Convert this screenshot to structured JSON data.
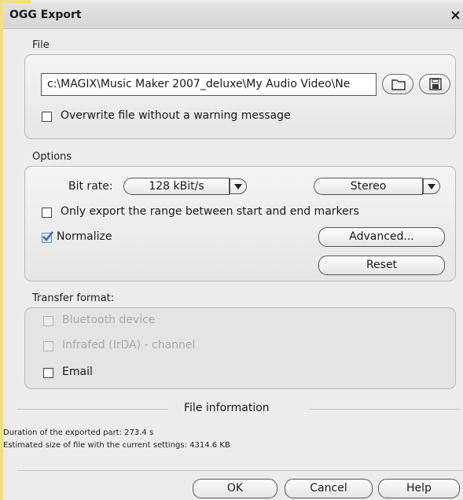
{
  "window": {
    "title": "OGG Export",
    "close_glyph": "×"
  },
  "file": {
    "section_label": "File",
    "path_value": "c:\\MAGIX\\Music Maker 2007_deluxe\\My Audio Video\\Ne",
    "overwrite_label": "Overwrite file without a warning message",
    "overwrite_checked": false
  },
  "options": {
    "section_label": "Options",
    "bitrate_label": "Bit rate:",
    "bitrate_value": "128 kBit/s",
    "channel_value": "Stereo",
    "range_label": "Only export the range between start and end markers",
    "range_checked": false,
    "normalize_label": "Normalize",
    "normalize_checked": true,
    "advanced_label": "Advanced...",
    "reset_label": "Reset"
  },
  "transfer": {
    "section_label": "Transfer format:",
    "items": [
      {
        "label": "Bluetooth device",
        "enabled": false,
        "checked": false
      },
      {
        "label": "Infrafed (IrDA) - channel",
        "enabled": false,
        "checked": false
      },
      {
        "label": "Email",
        "enabled": true,
        "checked": false
      }
    ]
  },
  "info": {
    "heading": "File information",
    "duration": "Duration of the exported part:  273.4 s",
    "size": "Estimated size of file with the current settings: 4314.6 KB"
  },
  "buttons": {
    "ok": "OK",
    "cancel": "Cancel",
    "help": "Help"
  },
  "icons": {
    "folder": "folder-icon",
    "save": "save-disk-icon"
  },
  "colors": {
    "checkmark": "#3a6fb0",
    "panel_border": "#b9b9b9"
  }
}
